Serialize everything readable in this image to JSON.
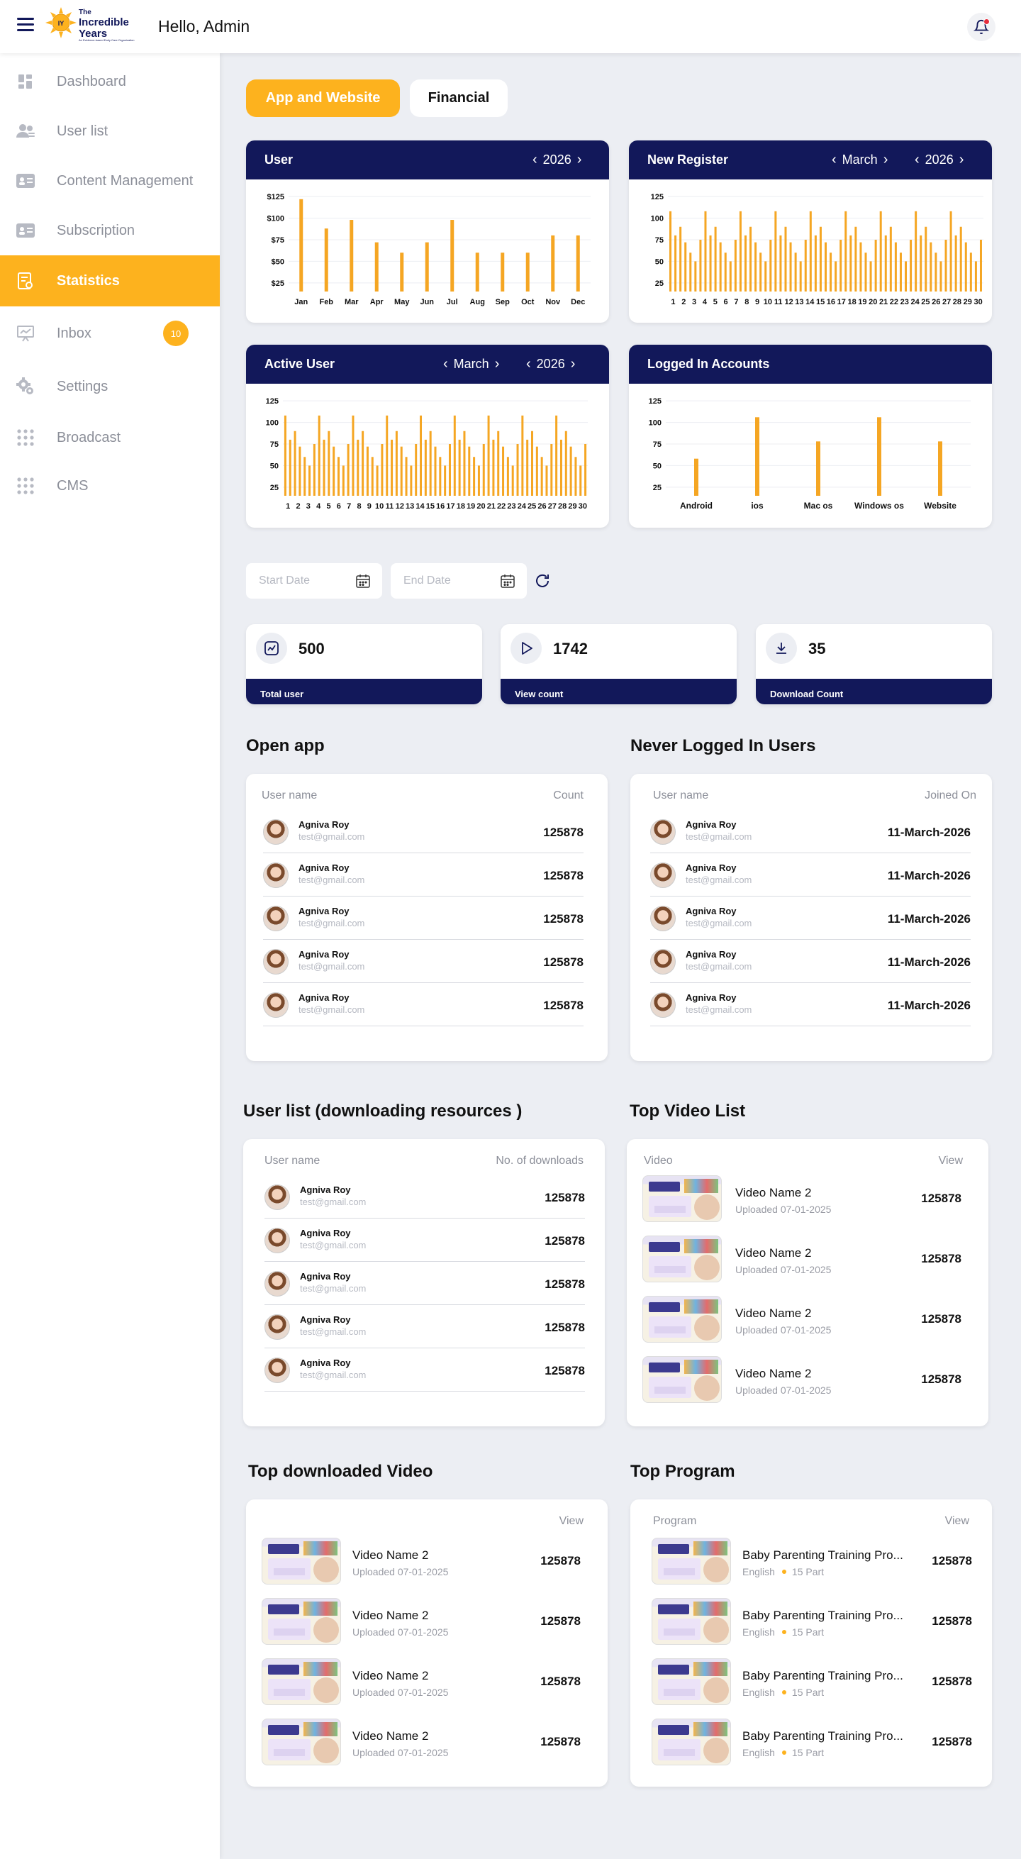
{
  "header": {
    "greeting": "Hello, Admin",
    "logo": {
      "line1": "The",
      "line2": "Incredible",
      "line3": "Years",
      "tagline": "An Evidence-based Early Care Organization"
    }
  },
  "sidebar": {
    "items": [
      {
        "label": "Dashboard",
        "icon": "dashboard-icon"
      },
      {
        "label": "User list",
        "icon": "users-icon"
      },
      {
        "label": "Content Management",
        "icon": "id-card-icon"
      },
      {
        "label": "Subscription",
        "icon": "id-card-icon"
      },
      {
        "label": "Statistics",
        "icon": "statistics-icon",
        "active": true
      },
      {
        "label": "Inbox",
        "icon": "presentation-icon",
        "badge": "10"
      },
      {
        "label": "Settings",
        "icon": "settings-gear-icon"
      },
      {
        "label": "Broadcast",
        "icon": "grid-dots-icon"
      },
      {
        "label": "CMS",
        "icon": "grid-dots-icon"
      }
    ]
  },
  "tabs": {
    "active": "App and Website",
    "inactive": "Financial"
  },
  "colors": {
    "accent": "#fdb21e",
    "navy": "#12185a",
    "bar": "#f5a623"
  },
  "charts": {
    "user": {
      "title": "User",
      "year": "2026"
    },
    "new_register": {
      "title": "New Register",
      "month": "March",
      "year": "2026"
    },
    "active_user": {
      "title": "Active User",
      "month": "March",
      "year": "2026"
    },
    "logged_in": {
      "title": "Logged In Accounts"
    }
  },
  "chart_data": [
    {
      "type": "bar",
      "title": "User",
      "categories": [
        "Jan",
        "Feb",
        "Mar",
        "Apr",
        "May",
        "Jun",
        "Jul",
        "Aug",
        "Sep",
        "Oct",
        "Nov",
        "Dec"
      ],
      "values": [
        122,
        88,
        98,
        72,
        60,
        72,
        98,
        60,
        60,
        60,
        80,
        80
      ],
      "ytick_labels": [
        "$25",
        "$50",
        "$75",
        "$100",
        "$125"
      ],
      "ylim": [
        15,
        135
      ],
      "grid": true
    },
    {
      "type": "bar",
      "title": "New Register",
      "categories": [
        "1",
        "2",
        "3",
        "4",
        "5",
        "6",
        "7",
        "8",
        "9",
        "10",
        "11",
        "12",
        "13",
        "14",
        "15",
        "16",
        "17",
        "18",
        "19",
        "20",
        "21",
        "22",
        "23",
        "24",
        "25",
        "26",
        "27",
        "28",
        "29",
        "30"
      ],
      "values": [
        108,
        80,
        90,
        72,
        60,
        50,
        75,
        108,
        80,
        90,
        72,
        60,
        50,
        75,
        108,
        80,
        90,
        72,
        60,
        50,
        75,
        108,
        80,
        90,
        72,
        60,
        50,
        75,
        108,
        80,
        90,
        72,
        60,
        50,
        75,
        108,
        80,
        90,
        72,
        60,
        50,
        75,
        108,
        80,
        90,
        72,
        60,
        50,
        75,
        108,
        80,
        90,
        72,
        60,
        50,
        75,
        108,
        80,
        90,
        72,
        60,
        50,
        75
      ],
      "ytick_labels": [
        "25",
        "50",
        "75",
        "100",
        "125"
      ],
      "ylim": [
        15,
        135
      ],
      "grid": true
    },
    {
      "type": "bar",
      "title": "Active User",
      "categories": [
        "1",
        "2",
        "3",
        "4",
        "5",
        "6",
        "7",
        "8",
        "9",
        "10",
        "11",
        "12",
        "13",
        "14",
        "15",
        "16",
        "17",
        "18",
        "19",
        "20",
        "21",
        "22",
        "23",
        "24",
        "25",
        "26",
        "27",
        "28",
        "29",
        "30"
      ],
      "values": [
        108,
        80,
        90,
        72,
        60,
        50,
        75,
        108,
        80,
        90,
        72,
        60,
        50,
        75,
        108,
        80,
        90,
        72,
        60,
        50,
        75,
        108,
        80,
        90,
        72,
        60,
        50,
        75,
        108,
        80,
        90,
        72,
        60,
        50,
        75,
        108,
        80,
        90,
        72,
        60,
        50,
        75,
        108,
        80,
        90,
        72,
        60,
        50,
        75,
        108,
        80,
        90,
        72,
        60,
        50,
        75,
        108,
        80,
        90,
        72,
        60,
        50,
        75
      ],
      "ytick_labels": [
        "25",
        "50",
        "75",
        "100",
        "125"
      ],
      "ylim": [
        15,
        135
      ],
      "grid": true
    },
    {
      "type": "bar",
      "title": "Logged In Accounts",
      "categories": [
        "Android",
        "ios",
        "Mac os",
        "Windows os",
        "Website"
      ],
      "values": [
        58,
        106,
        78,
        106,
        78
      ],
      "ytick_labels": [
        "25",
        "50",
        "75",
        "100",
        "125"
      ],
      "ylim": [
        15,
        135
      ],
      "grid": true
    }
  ],
  "filters": {
    "start_placeholder": "Start Date",
    "end_placeholder": "End Date"
  },
  "stats": [
    {
      "value": "500",
      "label": "Total user",
      "icon": "trend-chart-icon"
    },
    {
      "value": "1742",
      "label": "View count",
      "icon": "play-icon"
    },
    {
      "value": "35",
      "label": "Download Count",
      "icon": "download-icon"
    }
  ],
  "open_app": {
    "title": "Open app",
    "col1": "User name",
    "col2": "Count",
    "rows": [
      {
        "name": "Agniva Roy",
        "email": "test@gmail.com",
        "value": "125878"
      },
      {
        "name": "Agniva Roy",
        "email": "test@gmail.com",
        "value": "125878"
      },
      {
        "name": "Agniva Roy",
        "email": "test@gmail.com",
        "value": "125878"
      },
      {
        "name": "Agniva Roy",
        "email": "test@gmail.com",
        "value": "125878"
      },
      {
        "name": "Agniva Roy",
        "email": "test@gmail.com",
        "value": "125878"
      }
    ]
  },
  "never_logged": {
    "title": "Never Logged In Users",
    "col1": "User name",
    "col2": "Joined On",
    "rows": [
      {
        "name": "Agniva Roy",
        "email": "test@gmail.com",
        "value": "11-March-2026"
      },
      {
        "name": "Agniva Roy",
        "email": "test@gmail.com",
        "value": "11-March-2026"
      },
      {
        "name": "Agniva Roy",
        "email": "test@gmail.com",
        "value": "11-March-2026"
      },
      {
        "name": "Agniva Roy",
        "email": "test@gmail.com",
        "value": "11-March-2026"
      },
      {
        "name": "Agniva Roy",
        "email": "test@gmail.com",
        "value": "11-March-2026"
      }
    ]
  },
  "downloading": {
    "title": "User list (downloading resources )",
    "col1": "User name",
    "col2": "No. of downloads",
    "rows": [
      {
        "name": "Agniva Roy",
        "email": "test@gmail.com",
        "value": "125878"
      },
      {
        "name": "Agniva Roy",
        "email": "test@gmail.com",
        "value": "125878"
      },
      {
        "name": "Agniva Roy",
        "email": "test@gmail.com",
        "value": "125878"
      },
      {
        "name": "Agniva Roy",
        "email": "test@gmail.com",
        "value": "125878"
      },
      {
        "name": "Agniva Roy",
        "email": "test@gmail.com",
        "value": "125878"
      }
    ]
  },
  "top_video": {
    "title": "Top Video List",
    "col1": "Video",
    "col2": "View",
    "rows": [
      {
        "name": "Video Name 2",
        "sub": "Uploaded 07-01-2025",
        "value": "125878"
      },
      {
        "name": "Video Name 2",
        "sub": "Uploaded 07-01-2025",
        "value": "125878"
      },
      {
        "name": "Video Name 2",
        "sub": "Uploaded 07-01-2025",
        "value": "125878"
      },
      {
        "name": "Video Name 2",
        "sub": "Uploaded 07-01-2025",
        "value": "125878"
      }
    ]
  },
  "top_downloaded": {
    "title": "Top downloaded Video",
    "col2": "View",
    "rows": [
      {
        "name": "Video Name 2",
        "sub": "Uploaded 07-01-2025",
        "value": "125878"
      },
      {
        "name": "Video Name 2",
        "sub": "Uploaded 07-01-2025",
        "value": "125878"
      },
      {
        "name": "Video Name 2",
        "sub": "Uploaded 07-01-2025",
        "value": "125878"
      },
      {
        "name": "Video Name 2",
        "sub": "Uploaded 07-01-2025",
        "value": "125878"
      }
    ]
  },
  "top_program": {
    "title": "Top Program",
    "col1": "Program",
    "col2": "View",
    "rows": [
      {
        "name": "Baby Parenting Training Pro...",
        "lang": "English",
        "parts": "15 Part",
        "value": "125878"
      },
      {
        "name": "Baby Parenting Training Pro...",
        "lang": "English",
        "parts": "15 Part",
        "value": "125878"
      },
      {
        "name": "Baby Parenting Training Pro...",
        "lang": "English",
        "parts": "15 Part",
        "value": "125878"
      },
      {
        "name": "Baby Parenting Training Pro...",
        "lang": "English",
        "parts": "15 Part",
        "value": "125878"
      }
    ]
  }
}
